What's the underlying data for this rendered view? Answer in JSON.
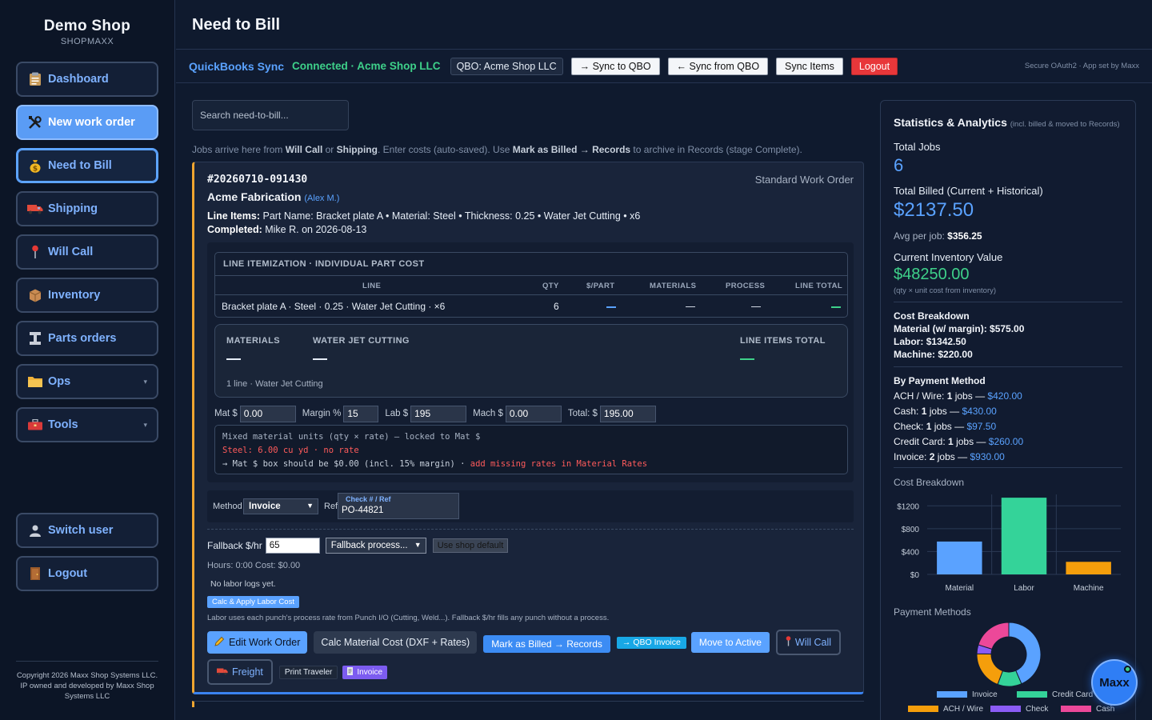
{
  "brand": {
    "name": "Demo Shop",
    "sub": "SHOPMAXX"
  },
  "nav": [
    {
      "label": "Dashboard",
      "icon": "clipboard-icon"
    },
    {
      "label": "New work order",
      "icon": "tools-icon"
    },
    {
      "label": "Need to Bill",
      "icon": "money-bag-icon"
    },
    {
      "label": "Shipping",
      "icon": "truck-icon"
    },
    {
      "label": "Will Call",
      "icon": "pin-icon"
    },
    {
      "label": "Inventory",
      "icon": "box-icon"
    },
    {
      "label": "Parts orders",
      "icon": "parts-icon"
    },
    {
      "label": "Ops",
      "icon": "folder-icon"
    },
    {
      "label": "Tools",
      "icon": "toolbox-icon"
    },
    {
      "label": "Switch user",
      "icon": "user-icon"
    },
    {
      "label": "Logout",
      "icon": "door-icon"
    }
  ],
  "copyright": "Copyright 2026 Maxx Shop Systems LLC. IP owned and developed by Maxx Shop Systems LLC",
  "header": {
    "title": "Need to Bill"
  },
  "sync": {
    "title": "QuickBooks Sync",
    "status": "Connected · Acme Shop LLC",
    "chip": "QBO: Acme Shop LLC",
    "sync_to": "→ Sync to QBO",
    "sync_from": "← Sync from QBO",
    "sync_items": "Sync Items",
    "logout": "Logout",
    "secure_note": "Secure OAuth2 · App set by Maxx"
  },
  "search": {
    "placeholder": "Search need-to-bill..."
  },
  "hint": {
    "p1": "Jobs arrive here from ",
    "b1": "Will Call",
    "p2": " or ",
    "b2": "Shipping",
    "p3": ". Enter costs (auto-saved). Use ",
    "b3": "Mark as Billed → Records",
    "p4": " to archive in Records (stage Complete)."
  },
  "job": {
    "id": "#20260710-091430",
    "type": "Standard Work Order",
    "customer": "Acme Fabrication",
    "customer_contact": "(Alex M.)",
    "line_items_label": "Line Items:",
    "line_items": "Part Name: Bracket plate A • Material: Steel • Thickness: 0.25 • Water Jet Cutting • x6",
    "completed_label": "Completed:",
    "completed": "Mike R. on 2026-08-13"
  },
  "itemization": {
    "title": "LINE ITEMIZATION · INDIVIDUAL PART COST",
    "headers": [
      "LINE",
      "QTY",
      "$/PART",
      "MATERIALS",
      "PROCESS",
      "LINE TOTAL"
    ],
    "row": {
      "line": "Bracket plate A · Steel · 0.25 · Water Jet Cutting · ×6",
      "qty": "6"
    }
  },
  "cost_summary": {
    "materials_label": "MATERIALS",
    "process_label": "WATER JET CUTTING",
    "total_label": "LINE ITEMS TOTAL",
    "note": "1 line · Water Jet Cutting"
  },
  "fields": {
    "mat_label": "Mat $",
    "mat_value": "0.00",
    "margin_label": "Margin %",
    "margin_value": "15",
    "lab_label": "Lab $",
    "lab_value": "195",
    "mach_label": "Mach $",
    "mach_value": "0.00",
    "total_label": "Total: $",
    "total_value": "195.00"
  },
  "warning": {
    "line1": "Mixed material units (qty × rate) — locked to Mat $",
    "line2": "Steel: 6.00 cu yd · no rate",
    "line3": "→ Mat $ box should be $0.00 (incl. 15% margin) · ",
    "line3_link": "add missing rates in Material Rates"
  },
  "payment": {
    "method_label": "Method",
    "method_value": "Invoice",
    "ref_label": "Ref",
    "ref_caption": "Check # / Ref",
    "ref_value": "PO-44821"
  },
  "labor": {
    "fallback_label": "Fallback $/hr",
    "fallback_value": "65",
    "fallback_process": "Fallback process...",
    "use_default": "Use shop default",
    "hours": "Hours: 0:00 Cost: $0.00",
    "no_logs": "No labor logs yet.",
    "calc_btn": "Calc & Apply Labor Cost",
    "note": "Labor uses each punch's process rate from Punch I/O (Cutting, Weld...). Fallback $/hr fills any punch without a process."
  },
  "actions": {
    "edit": "Edit Work Order",
    "calc_material": "Calc Material Cost (DXF + Rates)",
    "mark_billed": "Mark as Billed → Records",
    "qbo_invoice": "→ QBO Invoice",
    "move_active": "Move to Active",
    "will_call": "Will Call",
    "freight": "Freight",
    "print_traveler": "Print Traveler",
    "invoice": "Invoice"
  },
  "stats": {
    "title": "Statistics & Analytics",
    "title_note": "(incl. billed & moved to Records)",
    "total_jobs_label": "Total Jobs",
    "total_jobs": "6",
    "total_billed_label": "Total Billed (Current + Historical)",
    "total_billed": "$2137.50",
    "avg_label": "Avg per job:",
    "avg_value": "$356.25",
    "inventory_label": "Current Inventory Value",
    "inventory_value": "$48250.00",
    "inventory_note": "(qty × unit cost from inventory)",
    "breakdown_title": "Cost Breakdown",
    "material_label": "Material (w/ margin):",
    "material_value": "$575.00",
    "labor_label": "Labor:",
    "labor_value": "$1342.50",
    "machine_label": "Machine:",
    "machine_value": "$220.00",
    "by_payment_title": "By Payment Method",
    "payments": [
      {
        "name": "ACH / Wire:",
        "count": "1",
        "unit": "jobs —",
        "amount": "$420.00"
      },
      {
        "name": "Cash:",
        "count": "1",
        "unit": "jobs —",
        "amount": "$430.00"
      },
      {
        "name": "Check:",
        "count": "1",
        "unit": "jobs —",
        "amount": "$97.50"
      },
      {
        "name": "Credit Card:",
        "count": "1",
        "unit": "jobs —",
        "amount": "$260.00"
      },
      {
        "name": "Invoice:",
        "count": "2",
        "unit": "jobs —",
        "amount": "$930.00"
      }
    ],
    "chart_title": "Cost Breakdown",
    "pie_title": "Payment Methods"
  },
  "chart_data": [
    {
      "type": "bar",
      "title": "Cost Breakdown",
      "categories": [
        "Material",
        "Labor",
        "Machine"
      ],
      "values": [
        575.0,
        1342.5,
        220.0
      ],
      "y_ticks": [
        "$0",
        "$400",
        "$800",
        "$1200"
      ],
      "ylim": [
        0,
        1400
      ],
      "colors": [
        "#5aa2ff",
        "#34d399",
        "#f59e0b"
      ],
      "grid": true
    },
    {
      "type": "pie",
      "title": "Payment Methods",
      "categories": [
        "Invoice",
        "Credit Card",
        "ACH / Wire",
        "Check",
        "Cash"
      ],
      "values": [
        930.0,
        260.0,
        420.0,
        97.5,
        430.0
      ],
      "colors": [
        "#5aa2ff",
        "#34d399",
        "#f59e0b",
        "#8b5cf6",
        "#ec4899"
      ],
      "legend": "bottom"
    }
  ],
  "assistant": {
    "label": "Maxx"
  }
}
